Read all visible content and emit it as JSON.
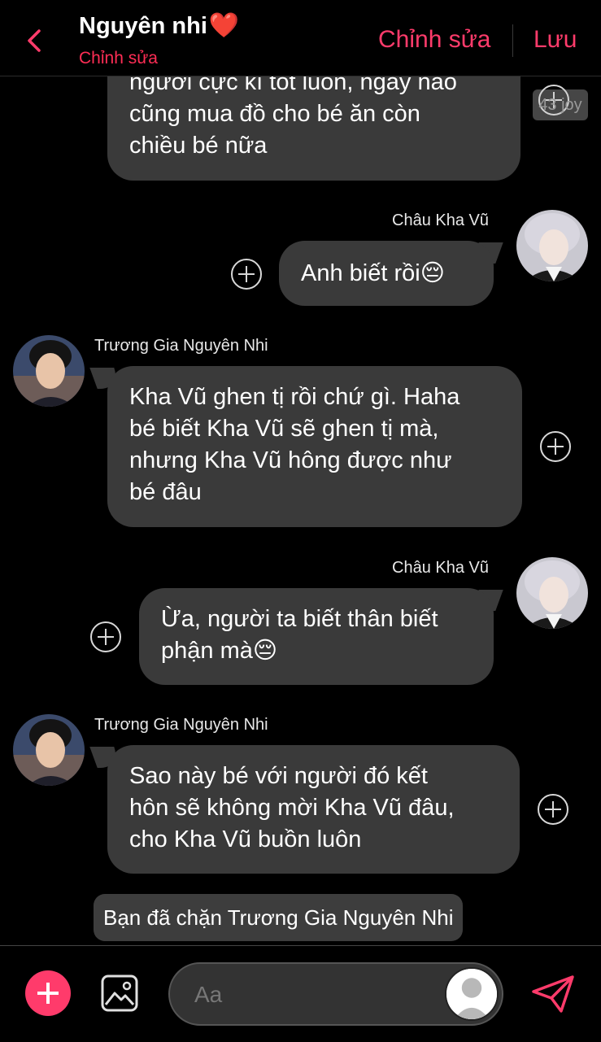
{
  "header": {
    "title": "Nguyên nhi",
    "heart": "❤️",
    "subtitle": "Chỉnh sửa",
    "edit_label": "Chỉnh sửa",
    "save_label": "Lưu"
  },
  "overlay_badge": "43 joy",
  "messages": [
    {
      "sender": "",
      "side": "left",
      "text": "người cực kì tốt luôn, ngày nào\ncũng mua đồ cho bé ăn còn\nchiều bé nữa"
    },
    {
      "sender": "Châu Kha Vũ",
      "side": "right",
      "text": "Anh biết rồi😔"
    },
    {
      "sender": "Trương Gia Nguyên Nhi",
      "side": "left",
      "text": "Kha Vũ ghen tị rồi chứ gì. Haha\nbé biết Kha Vũ sẽ ghen tị mà,\nnhưng Kha Vũ hông được như\nbé đâu"
    },
    {
      "sender": "Châu Kha Vũ",
      "side": "right",
      "text": "Ừa, người ta biết thân biết\nphận mà😔"
    },
    {
      "sender": "Trương Gia Nguyên Nhi",
      "side": "left",
      "text": "Sao này bé với người đó kết\nhôn sẽ không mời Kha Vũ đâu,\ncho Kha Vũ buồn luôn"
    }
  ],
  "blocked_notice": "Bạn đã chặn Trương Gia Nguyên Nhi",
  "composer": {
    "placeholder": "Aa"
  },
  "icons": {
    "back": "chevron-left-icon",
    "add": "plus-icon",
    "image": "image-icon",
    "send": "send-icon",
    "react": "plus-circle-icon"
  },
  "colors": {
    "accent": "#ff3b6b",
    "bubble": "#3a3a3a",
    "background": "#000000"
  }
}
